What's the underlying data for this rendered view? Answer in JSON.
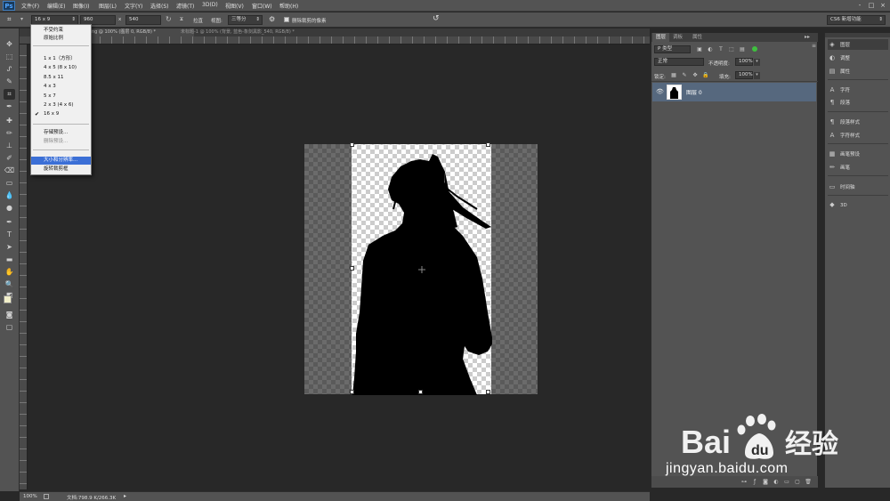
{
  "app": {
    "logo": "Ps"
  },
  "menu": [
    "文件(F)",
    "编辑(E)",
    "图像(I)",
    "图层(L)",
    "文字(Y)",
    "选择(S)",
    "滤镜(T)",
    "3D(D)",
    "视图(V)",
    "窗口(W)",
    "帮助(H)"
  ],
  "window_controls": [
    "-",
    "□",
    "×"
  ],
  "options": {
    "preset": "16 x 9",
    "width": "960",
    "swap": "x",
    "height": "540",
    "straighten_icon": "Ϫ",
    "straighten_label": "拉直",
    "view_label": "视图:",
    "view_value": "三等分",
    "delete_cropped_label": "删除裁剪的像素",
    "workspace": "CS6 新增功能"
  },
  "doc_tabs": [
    "ng @ 100% (图层 0, RGB/8) *",
    "未标题-1 @ 100% (背景, 蓝色-象剑黑影_540, RGB/8) *"
  ],
  "dropdown": {
    "items": [
      {
        "label": "不受约束",
        "state": "normal"
      },
      {
        "label": "原始比例",
        "state": "normal"
      },
      {
        "label": "1 x 1（方形）",
        "state": "normal"
      },
      {
        "label": "4 x 5 (8 x 10)",
        "state": "normal"
      },
      {
        "label": "8.5 x 11",
        "state": "normal"
      },
      {
        "label": "4 x 3",
        "state": "normal"
      },
      {
        "label": "5 x 7",
        "state": "normal"
      },
      {
        "label": "2 x 3 (4 x 6)",
        "state": "normal"
      },
      {
        "label": "16 x 9",
        "state": "checked"
      },
      {
        "label": "存储预设...",
        "state": "normal"
      },
      {
        "label": "删除预设...",
        "state": "disabled"
      },
      {
        "label": "大小和分辨率...",
        "state": "highlight"
      },
      {
        "label": "旋转裁剪框",
        "state": "normal"
      }
    ]
  },
  "status": {
    "zoom": "100%",
    "doc_info": "文档:798.9 K/266.3K"
  },
  "layers_panel": {
    "tabs": [
      "图层",
      "调板",
      "属性"
    ],
    "filter_kind": "P 类型",
    "blend_mode": "正常",
    "opacity_label": "不透明度:",
    "opacity_value": "100%",
    "lock_label": "锁定:",
    "fill_label": "填充:",
    "fill_value": "100%",
    "layers": [
      {
        "name": "图层 0"
      }
    ]
  },
  "dock": {
    "items": [
      "图层",
      "调整",
      "属性",
      "字符",
      "段落",
      "段落样式",
      "字符样式",
      "画笔预设",
      "画笔",
      "时间轴",
      "3D"
    ]
  },
  "watermark": {
    "brand": "Baidu 经验",
    "url": "jingyan.baidu.com"
  }
}
